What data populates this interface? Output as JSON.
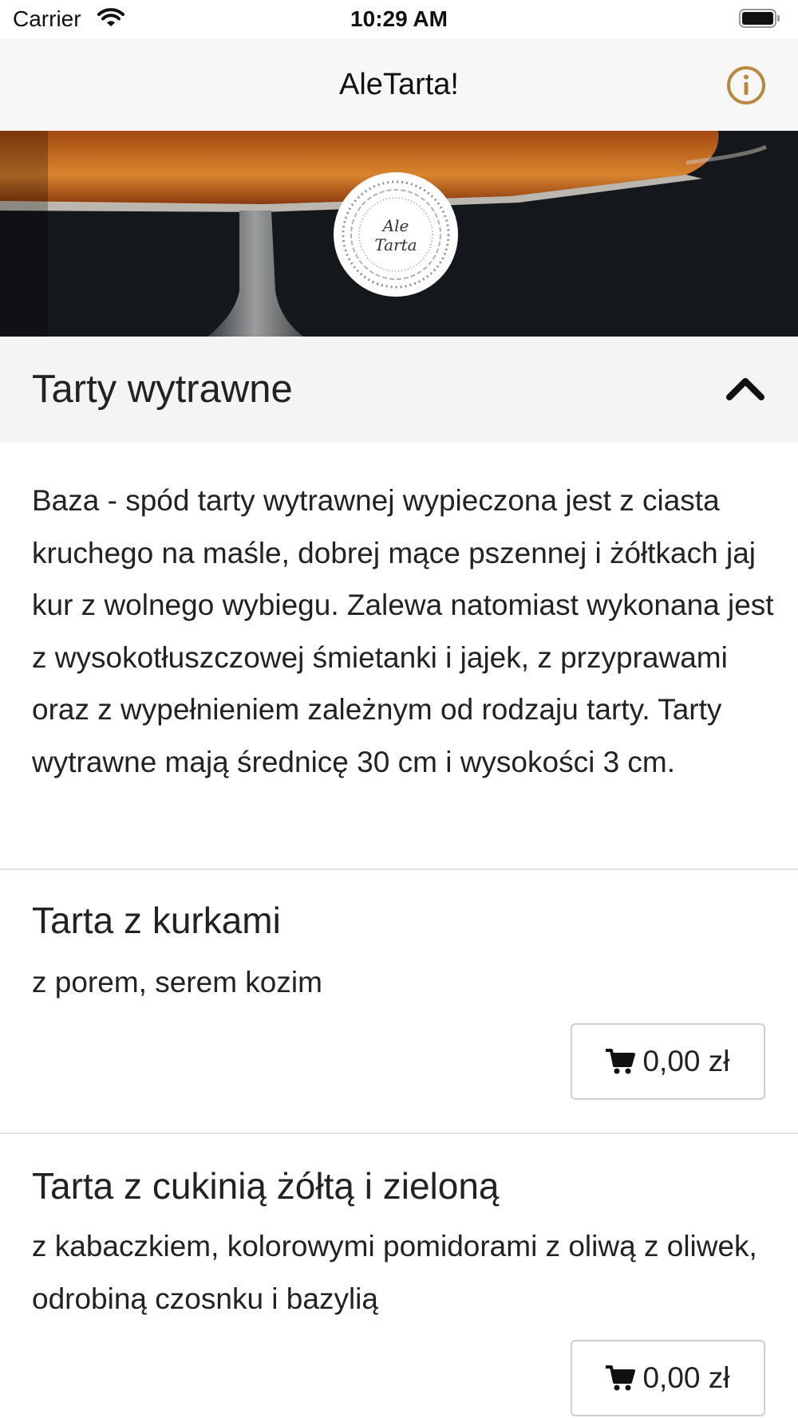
{
  "status_bar": {
    "carrier": "Carrier",
    "time": "10:29 AM"
  },
  "nav": {
    "title": "AleTarta!",
    "info_icon": "info-circle-icon"
  },
  "hero": {
    "logo_text_line1": "Ale",
    "logo_text_line2": "Tarta"
  },
  "section": {
    "title": "Tarty wytrawne",
    "expanded_icon": "chevron-up-icon",
    "description": "Baza - spód tarty wytrawnej wypieczona jest z ciasta kruchego na maśle, dobrej mące pszennej i żółtkach jaj kur z wolnego wybiegu. Zalewa natomiast wykonana jest z wysokotłuszczowej śmietanki i jajek, z przyprawami oraz z wypełnieniem zależnym od rodzaju tarty. Tarty wytrawne mają średnicę 30 cm i wysokości 3 cm."
  },
  "products": [
    {
      "name": "Tarta z kurkami",
      "description": "z porem, serem kozim",
      "price": "0,00 zł"
    },
    {
      "name": "Tarta z cukinią żółtą i zieloną",
      "description": "z kabaczkiem, kolorowymi pomidorami z oliwą z oliwek, odrobiną czosnku i bazylią",
      "price": "0,00 zł"
    }
  ],
  "colors": {
    "accent": "#b8893f",
    "nav_background": "#f7f7f7",
    "section_background": "#f4f4f4"
  }
}
